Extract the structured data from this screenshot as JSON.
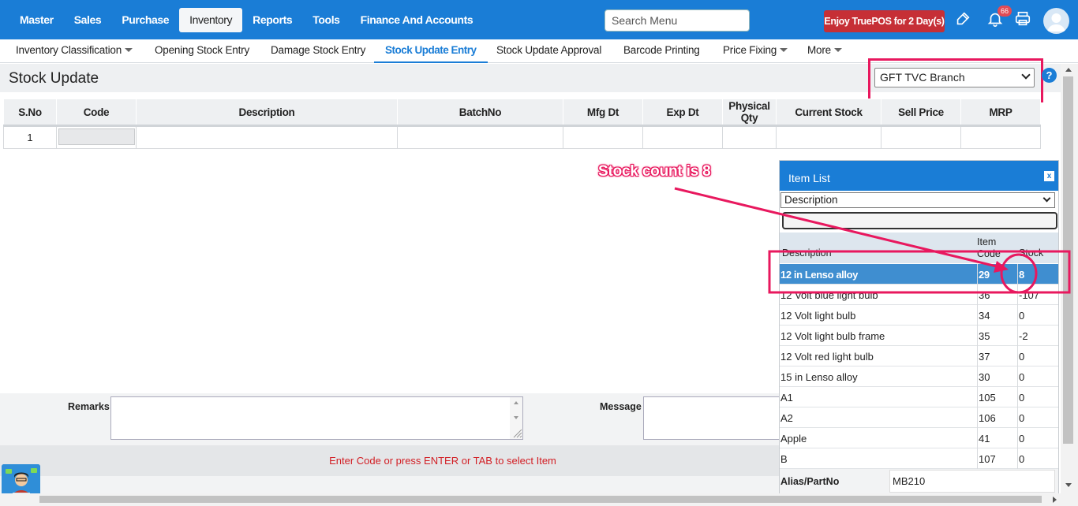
{
  "top_nav": {
    "items": [
      "Master",
      "Sales",
      "Purchase",
      "Inventory",
      "Reports",
      "Tools",
      "Finance And Accounts"
    ],
    "active": "Inventory",
    "search_placeholder": "Search Menu",
    "promo_label": "Enjoy TruePOS for 2 Day(s)",
    "notification_count": "66"
  },
  "sub_nav": {
    "items": [
      "Inventory Classification",
      "Opening Stock Entry",
      "Damage Stock Entry",
      "Stock Update Entry",
      "Stock Update Approval",
      "Barcode Printing",
      "Price Fixing",
      "More"
    ],
    "active": "Stock Update Entry"
  },
  "page": {
    "title": "Stock Update",
    "branch": "GFT TVC Branch",
    "help": "?"
  },
  "grid": {
    "headers": [
      "S.No",
      "Code",
      "Description",
      "BatchNo",
      "Mfg Dt",
      "Exp Dt",
      "Physical Qty",
      "Current Stock",
      "Sell Price",
      "MRP"
    ],
    "rows": [
      {
        "sno": "1",
        "code": "",
        "description": "",
        "batch": "",
        "mfg": "",
        "exp": "",
        "qty": "",
        "current": "",
        "sell": "",
        "mrp": ""
      }
    ]
  },
  "bottom": {
    "remarks_label": "Remarks",
    "message_label": "Message",
    "status": "Enter Code or press ENTER or TAB to select Item"
  },
  "item_list": {
    "title": "Item List",
    "close": "x",
    "search_by": "Description",
    "columns": {
      "description": "Description",
      "code": "Item Code",
      "stock": "Stock"
    },
    "rows": [
      {
        "description": "12 in Lenso alloy",
        "code": "29",
        "stock": "8"
      },
      {
        "description": "12 Volt blue light bulb",
        "code": "36",
        "stock": "-107"
      },
      {
        "description": "12 Volt light bulb",
        "code": "34",
        "stock": "0"
      },
      {
        "description": "12 Volt light bulb frame",
        "code": "35",
        "stock": "-2"
      },
      {
        "description": "12 Volt red light bulb",
        "code": "37",
        "stock": "0"
      },
      {
        "description": "15 in Lenso alloy",
        "code": "30",
        "stock": "0"
      },
      {
        "description": "A1",
        "code": "105",
        "stock": "0"
      },
      {
        "description": "A2",
        "code": "106",
        "stock": "0"
      },
      {
        "description": "Apple",
        "code": "41",
        "stock": "0"
      },
      {
        "description": "B",
        "code": "107",
        "stock": "0"
      }
    ],
    "selected_index": 0,
    "alias_label": "Alias/PartNo",
    "alias_value": "MB210"
  },
  "annotation": {
    "text": "Stock count is 8",
    "color": "#e8185e"
  },
  "colors": {
    "primary": "#1a7dd6",
    "promo": "#c62f36",
    "status_text": "#d21e24",
    "selected_row": "#3f8ed0"
  }
}
